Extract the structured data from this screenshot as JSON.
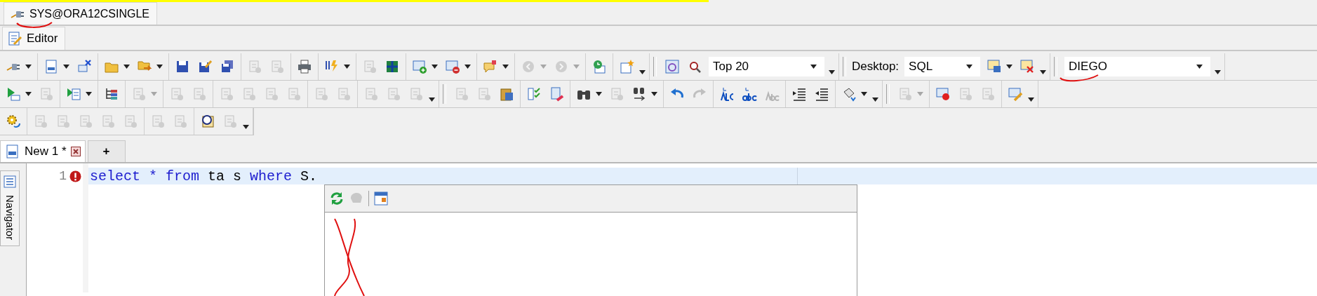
{
  "connection_tab": {
    "label": "SYS@ORA12CSINGLE",
    "selected": true
  },
  "view_tab": {
    "label": "Editor",
    "selected": true
  },
  "toolbars": [
    {
      "groups": [
        [
          {
            "kind": "button",
            "disabled": false,
            "dropdown": true
          }
        ],
        [
          {
            "kind": "button",
            "disabled": false,
            "dropdown": true
          },
          {
            "kind": "button",
            "disabled": false,
            "dropdown": false
          }
        ],
        [
          {
            "kind": "button",
            "disabled": false,
            "dropdown": true
          },
          {
            "kind": "button",
            "disabled": false,
            "dropdown": true
          }
        ],
        [
          {
            "kind": "button",
            "disabled": false,
            "dropdown": false
          },
          {
            "kind": "button",
            "disabled": false,
            "dropdown": false
          },
          {
            "kind": "button",
            "disabled": false,
            "dropdown": false
          }
        ],
        [
          {
            "kind": "button",
            "disabled": true,
            "dropdown": false
          },
          {
            "kind": "button",
            "disabled": true,
            "dropdown": false
          }
        ],
        [
          {
            "kind": "button",
            "disabled": false,
            "dropdown": false
          }
        ],
        [
          {
            "kind": "button",
            "disabled": false,
            "dropdown": true
          }
        ],
        [
          {
            "kind": "button",
            "disabled": true,
            "dropdown": false
          },
          {
            "kind": "button",
            "disabled": false,
            "dropdown": false
          }
        ],
        [
          {
            "kind": "button",
            "disabled": false,
            "dropdown": true
          },
          {
            "kind": "button",
            "disabled": false,
            "dropdown": true
          }
        ],
        [
          {
            "kind": "button",
            "disabled": false,
            "dropdown": true
          }
        ],
        [
          {
            "kind": "button",
            "disabled": true,
            "dropdown": true
          },
          {
            "kind": "button",
            "disabled": true,
            "dropdown": true
          }
        ],
        [
          {
            "kind": "button",
            "disabled": false,
            "dropdown": false
          }
        ],
        [
          {
            "kind": "button",
            "disabled": false,
            "dropdown": false
          },
          {
            "kind": "overflow"
          }
        ],
        [
          {
            "kind": "grip"
          },
          {
            "kind": "button",
            "disabled": false,
            "dropdown": false
          },
          {
            "kind": "button",
            "disabled": false,
            "dropdown": false
          },
          {
            "kind": "combo",
            "value": "Top 20"
          },
          {
            "kind": "overflow"
          }
        ],
        [
          {
            "kind": "grip"
          },
          {
            "kind": "label",
            "text": "Desktop:"
          },
          {
            "kind": "combo",
            "value": "SQL"
          },
          {
            "kind": "button",
            "disabled": false,
            "dropdown": true
          },
          {
            "kind": "button",
            "disabled": false,
            "dropdown": false
          },
          {
            "kind": "overflow"
          }
        ],
        [
          {
            "kind": "grip"
          },
          {
            "kind": "combo",
            "value": "DIEGO"
          },
          {
            "kind": "overflow"
          }
        ]
      ]
    },
    {
      "groups": [
        [
          {
            "kind": "button",
            "disabled": false,
            "dropdown": true
          },
          {
            "kind": "button",
            "disabled": true,
            "dropdown": false
          }
        ],
        [
          {
            "kind": "button",
            "disabled": false,
            "dropdown": true
          }
        ],
        [
          {
            "kind": "button",
            "disabled": false,
            "dropdown": false
          }
        ],
        [
          {
            "kind": "button",
            "disabled": true,
            "dropdown": true
          }
        ],
        [
          {
            "kind": "button",
            "disabled": true,
            "dropdown": false
          },
          {
            "kind": "button",
            "disabled": true,
            "dropdown": false
          }
        ],
        [
          {
            "kind": "button",
            "disabled": true,
            "dropdown": false
          },
          {
            "kind": "button",
            "disabled": true,
            "dropdown": false
          },
          {
            "kind": "button",
            "disabled": true,
            "dropdown": false
          },
          {
            "kind": "button",
            "disabled": true,
            "dropdown": false
          }
        ],
        [
          {
            "kind": "button",
            "disabled": true,
            "dropdown": false
          },
          {
            "kind": "button",
            "disabled": true,
            "dropdown": false
          }
        ],
        [
          {
            "kind": "button",
            "disabled": true,
            "dropdown": false
          },
          {
            "kind": "button",
            "disabled": true,
            "dropdown": false
          },
          {
            "kind": "button",
            "disabled": true,
            "dropdown": false
          },
          {
            "kind": "overflow"
          }
        ],
        [
          {
            "kind": "grip"
          },
          {
            "kind": "button",
            "disabled": true,
            "dropdown": false
          },
          {
            "kind": "button",
            "disabled": true,
            "dropdown": false
          },
          {
            "kind": "button",
            "disabled": false,
            "dropdown": false
          }
        ],
        [
          {
            "kind": "button",
            "disabled": false,
            "dropdown": false
          },
          {
            "kind": "button",
            "disabled": false,
            "dropdown": false
          }
        ],
        [
          {
            "kind": "button",
            "disabled": false,
            "dropdown": true
          },
          {
            "kind": "button",
            "disabled": true,
            "dropdown": false
          },
          {
            "kind": "button",
            "disabled": false,
            "dropdown": true
          }
        ],
        [
          {
            "kind": "button",
            "disabled": false,
            "dropdown": false
          },
          {
            "kind": "button",
            "disabled": true,
            "dropdown": false
          }
        ],
        [
          {
            "kind": "button",
            "disabled": false,
            "dropdown": false
          },
          {
            "kind": "button",
            "disabled": false,
            "dropdown": false
          },
          {
            "kind": "button",
            "disabled": true,
            "dropdown": false
          }
        ],
        [
          {
            "kind": "button",
            "disabled": false,
            "dropdown": false
          },
          {
            "kind": "button",
            "disabled": false,
            "dropdown": false
          }
        ],
        [
          {
            "kind": "button",
            "disabled": false,
            "dropdown": true
          },
          {
            "kind": "overflow"
          }
        ],
        [
          {
            "kind": "grip"
          },
          {
            "kind": "button",
            "disabled": true,
            "dropdown": true
          }
        ],
        [
          {
            "kind": "button",
            "disabled": false,
            "dropdown": false
          },
          {
            "kind": "button",
            "disabled": true,
            "dropdown": false
          },
          {
            "kind": "button",
            "disabled": true,
            "dropdown": false
          }
        ],
        [
          {
            "kind": "button",
            "disabled": false,
            "dropdown": false
          },
          {
            "kind": "overflow"
          }
        ]
      ]
    },
    {
      "groups": [
        [
          {
            "kind": "button",
            "disabled": false,
            "dropdown": false
          }
        ],
        [
          {
            "kind": "button",
            "disabled": true,
            "dropdown": false
          },
          {
            "kind": "button",
            "disabled": true,
            "dropdown": false
          },
          {
            "kind": "button",
            "disabled": true,
            "dropdown": false
          },
          {
            "kind": "button",
            "disabled": true,
            "dropdown": false
          },
          {
            "kind": "button",
            "disabled": true,
            "dropdown": false
          }
        ],
        [
          {
            "kind": "button",
            "disabled": true,
            "dropdown": false
          },
          {
            "kind": "button",
            "disabled": true,
            "dropdown": false
          }
        ],
        [
          {
            "kind": "button",
            "disabled": false,
            "dropdown": false
          },
          {
            "kind": "button",
            "disabled": true,
            "dropdown": false
          },
          {
            "kind": "overflow"
          }
        ]
      ]
    }
  ],
  "editor_tabs": [
    {
      "kind": "document",
      "label": "New 1 *",
      "selected": true
    },
    {
      "kind": "add",
      "label": "+",
      "selected": false
    }
  ],
  "side_tab": {
    "label": "Navigator"
  },
  "editor": {
    "lines": [
      {
        "number": "1",
        "has_error": true,
        "current": true,
        "tokens": [
          {
            "kind": "keyword",
            "text": "select"
          },
          {
            "kind": "keyword",
            "text": "*"
          },
          {
            "kind": "keyword",
            "text": "from"
          },
          {
            "kind": "plain",
            "text": "ta"
          },
          {
            "kind": "plain",
            "text": "s"
          },
          {
            "kind": "keyword",
            "text": "where"
          },
          {
            "kind": "plain",
            "text": "S."
          }
        ]
      }
    ]
  },
  "completion_popup": {
    "toolbar": [
      {
        "disabled": false
      },
      {
        "disabled": true
      },
      {
        "disabled": false
      }
    ]
  }
}
